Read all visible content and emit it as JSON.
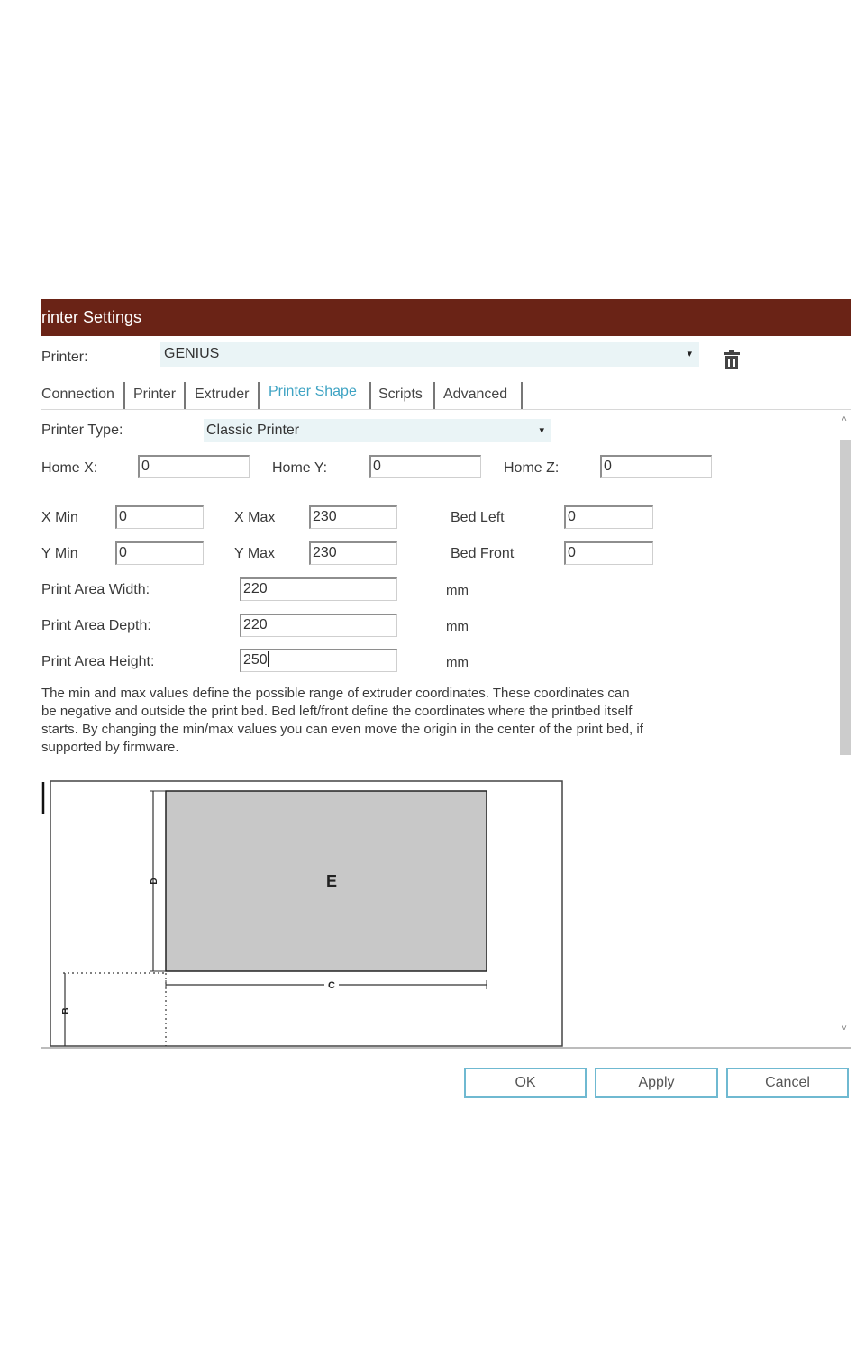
{
  "window": {
    "title": "rinter Settings"
  },
  "printer_row": {
    "label": "Printer:",
    "value": "GENIUS"
  },
  "tabs": [
    {
      "label": "Connection",
      "active": false
    },
    {
      "label": "Printer",
      "active": false
    },
    {
      "label": "Extruder",
      "active": false
    },
    {
      "label": "Printer Shape",
      "active": true
    },
    {
      "label": "Scripts",
      "active": false
    },
    {
      "label": "Advanced",
      "active": false
    }
  ],
  "printer_type": {
    "label": "Printer Type:",
    "value": "Classic Printer"
  },
  "home": {
    "x_label": "Home X:",
    "x_value": "0",
    "y_label": "Home Y:",
    "y_value": "0",
    "z_label": "Home Z:",
    "z_value": "0"
  },
  "limits": {
    "xmin_label": "X Min",
    "xmin_value": "0",
    "xmax_label": "X Max",
    "xmax_value": "230",
    "bedleft_label": "Bed Left",
    "bedleft_value": "0",
    "ymin_label": "Y Min",
    "ymin_value": "0",
    "ymax_label": "Y Max",
    "ymax_value": "230",
    "bedfront_label": "Bed Front",
    "bedfront_value": "0"
  },
  "area": {
    "width_label": "Print Area Width:",
    "width_value": "220",
    "depth_label": "Print Area Depth:",
    "depth_value": "220",
    "height_label": "Print Area Height:",
    "height_value": "250",
    "unit": "mm"
  },
  "description": {
    "line1": "The min and max values define the possible range of extruder coordinates. These coordinates can",
    "line2": "be negative and outside the print bed. Bed left/front define the coordinates where the printbed itself",
    "line3": "starts. By changing the min/max values you can even move the origin in the center of the print bed, if",
    "line4": "supported by firmware."
  },
  "diagram": {
    "bed_label": "E",
    "width_label": "C",
    "depth_label": "D",
    "front_label": "B"
  },
  "buttons": {
    "ok": "OK",
    "apply": "Apply",
    "cancel": "Cancel"
  },
  "colors": {
    "titlebar": "#6a2316",
    "accent": "#3ea3c3",
    "button_border": "#6fb9d1",
    "select_bg": "#eaf4f6",
    "bed_fill": "#c8c8c8"
  }
}
